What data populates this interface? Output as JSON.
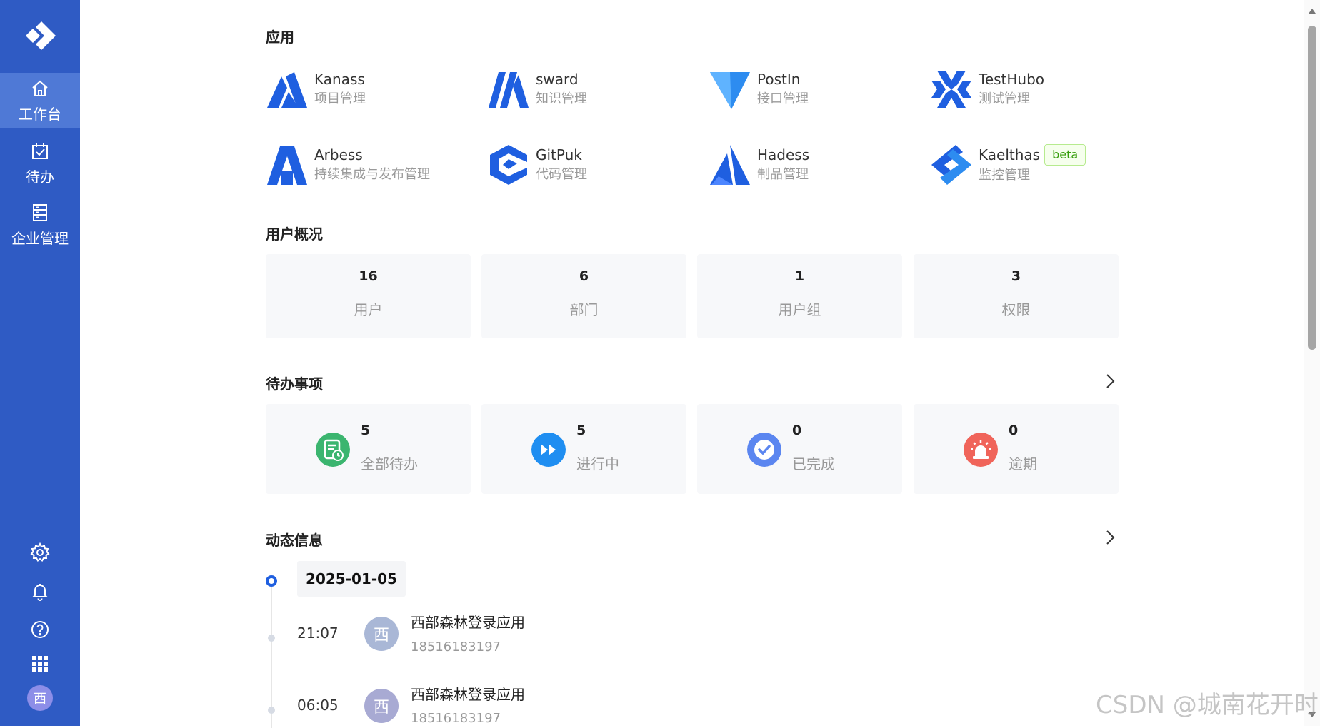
{
  "sidebar": {
    "nav": [
      {
        "label": "工作台",
        "icon": "home-icon",
        "active": true
      },
      {
        "label": "待办",
        "icon": "calendar-check-icon",
        "active": false
      },
      {
        "label": "企业管理",
        "icon": "enterprise-list-icon",
        "active": false
      }
    ],
    "bottom_icons": [
      "settings-icon",
      "bell-icon",
      "help-icon",
      "apps-grid-icon"
    ],
    "avatar": "西"
  },
  "apps": {
    "title": "应用",
    "items": [
      {
        "name": "Kanass",
        "desc": "项目管理"
      },
      {
        "name": "sward",
        "desc": "知识管理"
      },
      {
        "name": "PostIn",
        "desc": "接口管理"
      },
      {
        "name": "TestHubo",
        "desc": "测试管理"
      },
      {
        "name": "Arbess",
        "desc": "持续集成与发布管理"
      },
      {
        "name": "GitPuk",
        "desc": "代码管理"
      },
      {
        "name": "Hadess",
        "desc": "制品管理"
      },
      {
        "name": "Kaelthas",
        "desc": "监控管理",
        "badge": "beta"
      }
    ]
  },
  "overview": {
    "title": "用户概况",
    "stats": [
      {
        "value": "16",
        "label": "用户"
      },
      {
        "value": "6",
        "label": "部门"
      },
      {
        "value": "1",
        "label": "用户组"
      },
      {
        "value": "3",
        "label": "权限"
      }
    ]
  },
  "todo": {
    "title": "待办事项",
    "items": [
      {
        "value": "5",
        "label": "全部待办",
        "icon": "todo-list-icon",
        "color": "#3bb56f"
      },
      {
        "value": "5",
        "label": "进行中",
        "icon": "fast-forward-icon",
        "color": "#1f8ef1"
      },
      {
        "value": "0",
        "label": "已完成",
        "icon": "check-circle-icon",
        "color": "#5b86f0"
      },
      {
        "value": "0",
        "label": "逾期",
        "icon": "alarm-icon",
        "color": "#f0645a"
      }
    ]
  },
  "activity": {
    "title": "动态信息",
    "date": "2025-01-05",
    "entries": [
      {
        "time": "21:07",
        "avatar": "西",
        "title": "西部森林登录应用",
        "phone": "18516183197"
      },
      {
        "time": "06:05",
        "avatar": "西",
        "title": "西部森林登录应用",
        "phone": "18516183197"
      }
    ]
  },
  "watermark": "CSDN @城南花开时",
  "colors": {
    "sidebar": "#2f5bc4",
    "sidebar_active": "#4f79d6",
    "brand_blue": "#1f5fe0"
  }
}
